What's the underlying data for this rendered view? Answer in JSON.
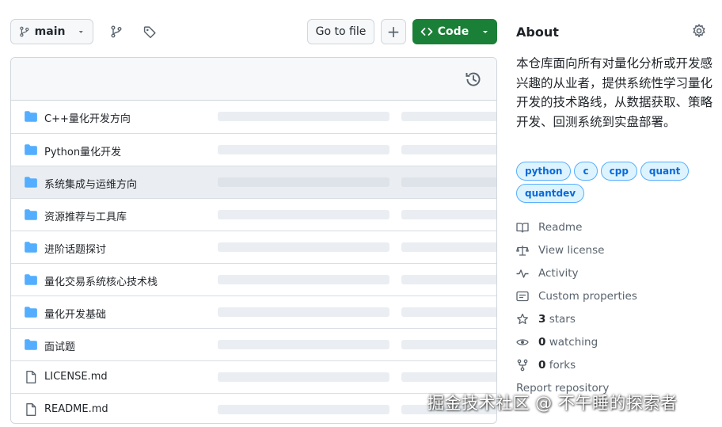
{
  "toolbar": {
    "branch_label": "main",
    "goto_file_label": "Go to file",
    "plus_label": "+",
    "code_label": "Code"
  },
  "files": [
    {
      "name": "C++量化开发方向",
      "type": "folder"
    },
    {
      "name": "Python量化开发",
      "type": "folder"
    },
    {
      "name": "系统集成与运维方向",
      "type": "folder"
    },
    {
      "name": "资源推荐与工具库",
      "type": "folder"
    },
    {
      "name": "进阶话题探讨",
      "type": "folder"
    },
    {
      "name": "量化交易系统核心技术栈",
      "type": "folder"
    },
    {
      "name": "量化开发基础",
      "type": "folder"
    },
    {
      "name": "面试题",
      "type": "folder"
    },
    {
      "name": "LICENSE.md",
      "type": "file"
    },
    {
      "name": "README.md",
      "type": "file"
    }
  ],
  "about": {
    "title": "About",
    "description": "本仓库面向所有对量化分析或开发感兴趣的从业者，提供系统性学习量化开发的技术路线，从数据获取、策略开发、回测系统到实盘部署。",
    "topics": [
      "python",
      "c",
      "cpp",
      "quant",
      "quantdev"
    ],
    "links": {
      "readme": "Readme",
      "license": "View license",
      "activity": "Activity",
      "custom_properties": "Custom properties",
      "stars_count": "3",
      "stars_label": "stars",
      "watching_count": "0",
      "watching_label": "watching",
      "forks_count": "0",
      "forks_label": "forks",
      "report": "Report repository"
    }
  },
  "watermark": "掘金技术社区 @ 不午睡的探索者",
  "colors": {
    "accent_green": "#1a7f37",
    "folder_blue": "#54aeff",
    "topic_bg": "#ddf4ff",
    "topic_text": "#0969da"
  }
}
